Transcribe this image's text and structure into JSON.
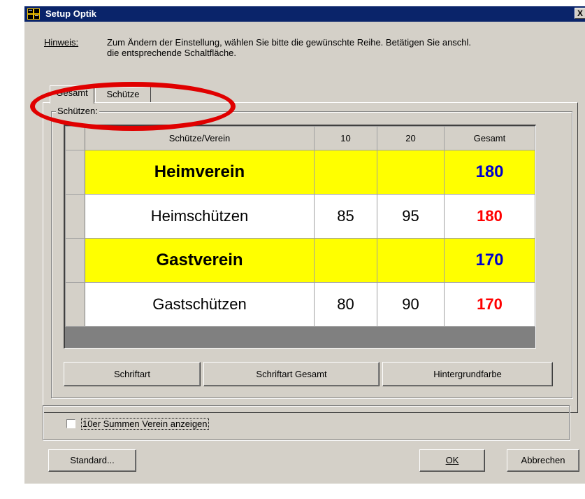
{
  "window": {
    "title": "Setup Optik",
    "close_label": "X",
    "icon": "app-grid-icon"
  },
  "hint": {
    "label": "Hinweis:",
    "text_line1": "Zum Ändern der Einstellung, wählen Sie bitte die gewünschte Reihe. Betätigen Sie anschl.",
    "text_line2": "die entsprechende Schaltfläche."
  },
  "tabs": [
    {
      "label": "Gesamt",
      "selected": true
    },
    {
      "label": "Schütze",
      "selected": false
    }
  ],
  "group": {
    "legend": "Schützen:"
  },
  "table": {
    "headers": [
      "Schütze/Verein",
      "10",
      "20",
      "Gesamt"
    ],
    "rows": [
      {
        "type": "club",
        "name": "Heimverein",
        "v10": "",
        "v20": "",
        "total": "180",
        "total_color": "#0000cc",
        "bg": "#ffff00"
      },
      {
        "type": "shooter",
        "name": "Heimschützen",
        "v10": "85",
        "v20": "95",
        "total": "180",
        "total_color": "#ff0000",
        "bg": "#ffffff"
      },
      {
        "type": "club",
        "name": "Gastverein",
        "v10": "",
        "v20": "",
        "total": "170",
        "total_color": "#0000cc",
        "bg": "#ffff00"
      },
      {
        "type": "shooter",
        "name": "Gastschützen",
        "v10": "80",
        "v20": "90",
        "total": "170",
        "total_color": "#ff0000",
        "bg": "#ffffff"
      }
    ]
  },
  "buttons": {
    "font": "Schriftart",
    "font_total": "Schriftart Gesamt",
    "background": "Hintergrundfarbe",
    "standard": "Standard...",
    "ok": "OK",
    "cancel": "Abbrechen"
  },
  "options": {
    "checkbox_label": "10er Summen Verein anzeigen",
    "checked": false
  },
  "annotation": {
    "color": "#e00000"
  }
}
